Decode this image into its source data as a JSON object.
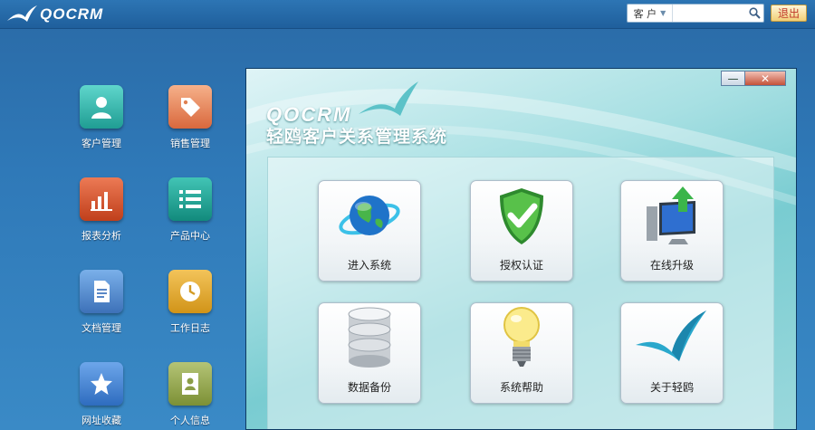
{
  "header": {
    "brand": "QOCRM",
    "search": {
      "category": "客 户",
      "placeholder": ""
    },
    "logout_label": "退出"
  },
  "desktop": {
    "items": [
      {
        "label": "客户管理",
        "icon": "person-icon",
        "color": "#2bb3a8"
      },
      {
        "label": "销售管理",
        "icon": "price-tag-icon",
        "color": "#e8865a"
      },
      {
        "label": "报表分析",
        "icon": "bar-chart-icon",
        "color": "#d9502b"
      },
      {
        "label": "产品中心",
        "icon": "list-icon",
        "color": "#1aa596"
      },
      {
        "label": "文档管理",
        "icon": "document-icon",
        "color": "#4f86cc"
      },
      {
        "label": "工作日志",
        "icon": "clock-icon",
        "color": "#e3a830"
      },
      {
        "label": "网址收藏",
        "icon": "star-icon",
        "color": "#3a7fd0"
      },
      {
        "label": "个人信息",
        "icon": "id-card-icon",
        "color": "#8fa346"
      }
    ]
  },
  "window": {
    "brand": "QOCRM",
    "title": "轻鸥客户关系管理系统",
    "controls": {
      "minimize": "—",
      "close": "✕"
    },
    "tiles": [
      {
        "label": "进入系统",
        "icon": "globe-icon"
      },
      {
        "label": "授权认证",
        "icon": "shield-check-icon"
      },
      {
        "label": "在线升级",
        "icon": "monitor-upgrade-icon"
      },
      {
        "label": "数据备份",
        "icon": "database-icon"
      },
      {
        "label": "系统帮助",
        "icon": "lightbulb-icon"
      },
      {
        "label": "关于轻鸥",
        "icon": "seagull-icon"
      }
    ]
  }
}
